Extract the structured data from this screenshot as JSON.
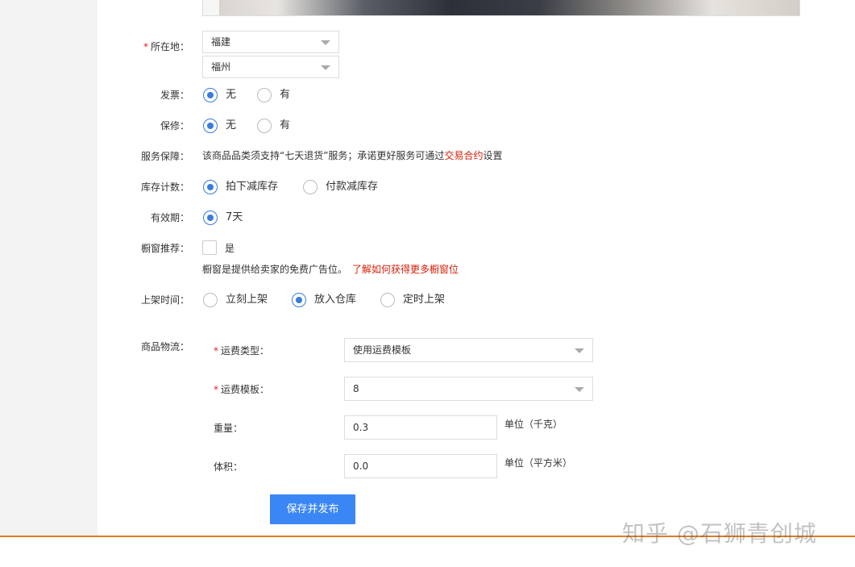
{
  "location": {
    "label": "所在地：",
    "province": "福建",
    "city": "福州"
  },
  "invoice": {
    "label": "发票：",
    "options": [
      "无",
      "有"
    ],
    "selected": "无"
  },
  "warranty": {
    "label": "保修：",
    "options": [
      "无",
      "有"
    ],
    "selected": "无"
  },
  "service": {
    "label": "服务保障：",
    "text_before": "该商品品类须支持“七天退货”服务；承诺更好服务可通过",
    "link": "交易合约",
    "text_after": "设置"
  },
  "stock": {
    "label": "库存计数：",
    "options": [
      "拍下减库存",
      "付款减库存"
    ],
    "selected": "拍下减库存"
  },
  "validity": {
    "label": "有效期：",
    "options": [
      "7天"
    ],
    "selected": "7天"
  },
  "showcase": {
    "label": "橱窗推荐：",
    "checkbox_label": "是",
    "hint": "橱窗是提供给卖家的免费广告位。",
    "hint_link": "了解如何获得更多橱窗位"
  },
  "listing_time": {
    "label": "上架时间：",
    "options": [
      "立刻上架",
      "放入仓库",
      "定时上架"
    ],
    "selected": "放入仓库"
  },
  "logistics": {
    "label": "商品物流：",
    "fee_type_label": "运费类型：",
    "fee_type_value": "使用运费模板",
    "fee_template_label": "运费模板：",
    "fee_template_value": "8",
    "weight_label": "重量：",
    "weight_value": "0.3",
    "weight_unit": "单位（千克）",
    "volume_label": "体积：",
    "volume_value": "0.0",
    "volume_unit": "单位（平方米）"
  },
  "submit_label": "保存并发布",
  "watermark": "知乎 @石狮青创城",
  "colors": {
    "accent": "#3b86f5",
    "required": "#e0242a",
    "link_red": "#d81e06",
    "divider": "#e07b22"
  }
}
